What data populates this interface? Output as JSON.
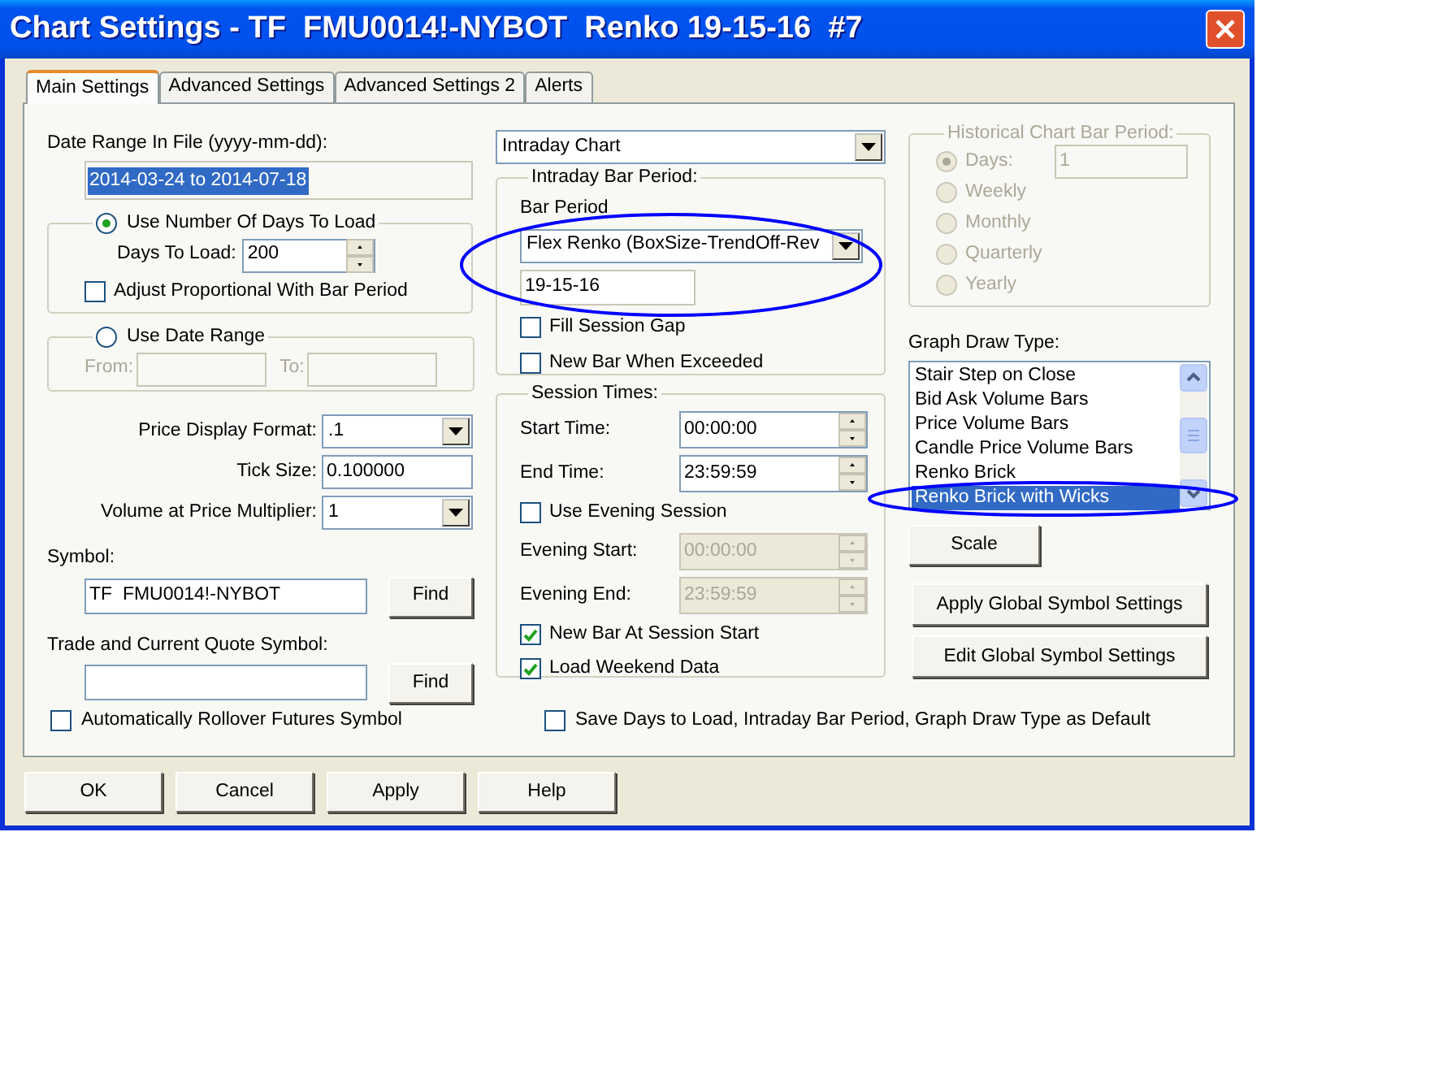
{
  "window": {
    "title": "Chart Settings - TF  FMU0014!-NYBOT  Renko 19-15-16  #7"
  },
  "tabs": [
    {
      "label": "Main Settings",
      "selected": true
    },
    {
      "label": "Advanced Settings",
      "selected": false
    },
    {
      "label": "Advanced Settings 2",
      "selected": false
    },
    {
      "label": "Alerts",
      "selected": false
    }
  ],
  "date_range": {
    "label": "Date Range In File (yyyy-mm-dd):",
    "value": "2014-03-24 to 2014-07-18"
  },
  "days_group": {
    "label": "Use Number Of Days To Load",
    "selected": true,
    "days_label": "Days To Load:",
    "days_value": "200",
    "adjust": {
      "label": "Adjust Proportional With Bar Period",
      "checked": false
    }
  },
  "range_group": {
    "label": "Use Date Range",
    "selected": false,
    "from_label": "From:",
    "to_label": "To:"
  },
  "format_rows": [
    {
      "kind": "select",
      "label": "Price Display Format:",
      "value": ".1"
    },
    {
      "kind": "text",
      "label": "Tick Size:",
      "value": "0.100000"
    },
    {
      "kind": "select",
      "label": "Volume at Price Multiplier:",
      "value": "1"
    }
  ],
  "symbol": {
    "label": "Symbol:",
    "value": "TF  FMU0014!-NYBOT",
    "button": "Find"
  },
  "quote_symbol": {
    "label": "Trade and Current Quote Symbol:",
    "button": "Find"
  },
  "rollover": {
    "label": "Automatically Rollover Futures Symbol",
    "checked": false
  },
  "chart_type": {
    "value": "Intraday Chart"
  },
  "intraday": {
    "title": "Intraday Bar Period:",
    "bar_period_label": "Bar Period",
    "bar_period_value": "Flex Renko (BoxSize-TrendOff-Rev",
    "period_value": "19-15-16",
    "options": [
      {
        "label": "Fill Session Gap",
        "checked": false
      },
      {
        "label": "New Bar When Exceeded",
        "checked": false
      }
    ]
  },
  "session": {
    "title": "Session Times:",
    "rows": [
      {
        "kind": "time",
        "label": "Start Time:",
        "value": "00:00:00",
        "disabled": false
      },
      {
        "kind": "time",
        "label": "End Time:",
        "value": "23:59:59",
        "disabled": false
      },
      {
        "kind": "checkbox",
        "label": "Use Evening Session",
        "checked": false
      },
      {
        "kind": "time",
        "label": "Evening Start:",
        "value": "00:00:00",
        "disabled": true
      },
      {
        "kind": "time",
        "label": "Evening End:",
        "value": "23:59:59",
        "disabled": true
      },
      {
        "kind": "checkbox",
        "label": "New Bar At Session Start",
        "checked": true
      },
      {
        "kind": "checkbox",
        "label": "Load Weekend Data",
        "checked": true
      }
    ]
  },
  "historical": {
    "title": "Historical Chart Bar Period:",
    "disabled": true,
    "days_value": "1",
    "options": [
      {
        "label": "Days:",
        "selected": true
      },
      {
        "label": "Weekly",
        "selected": false
      },
      {
        "label": "Monthly",
        "selected": false
      },
      {
        "label": "Quarterly",
        "selected": false
      },
      {
        "label": "Yearly",
        "selected": false
      }
    ]
  },
  "graph_draw": {
    "label": "Graph Draw Type:",
    "items": [
      {
        "label": "Stair Step on Close",
        "selected": false
      },
      {
        "label": "Bid Ask Volume Bars",
        "selected": false
      },
      {
        "label": "Price Volume Bars",
        "selected": false
      },
      {
        "label": "Candle Price Volume Bars",
        "selected": false
      },
      {
        "label": "Renko Brick",
        "selected": false
      },
      {
        "label": "Renko Brick with Wicks",
        "selected": true
      }
    ]
  },
  "scale_button": "Scale",
  "global_buttons": [
    "Apply Global Symbol Settings",
    "Edit Global Symbol Settings"
  ],
  "save_default": {
    "label": "Save Days to Load, Intraday Bar Period, Graph Draw Type as Default",
    "checked": false
  },
  "footer_buttons": [
    "OK",
    "Cancel",
    "Apply",
    "Help"
  ]
}
